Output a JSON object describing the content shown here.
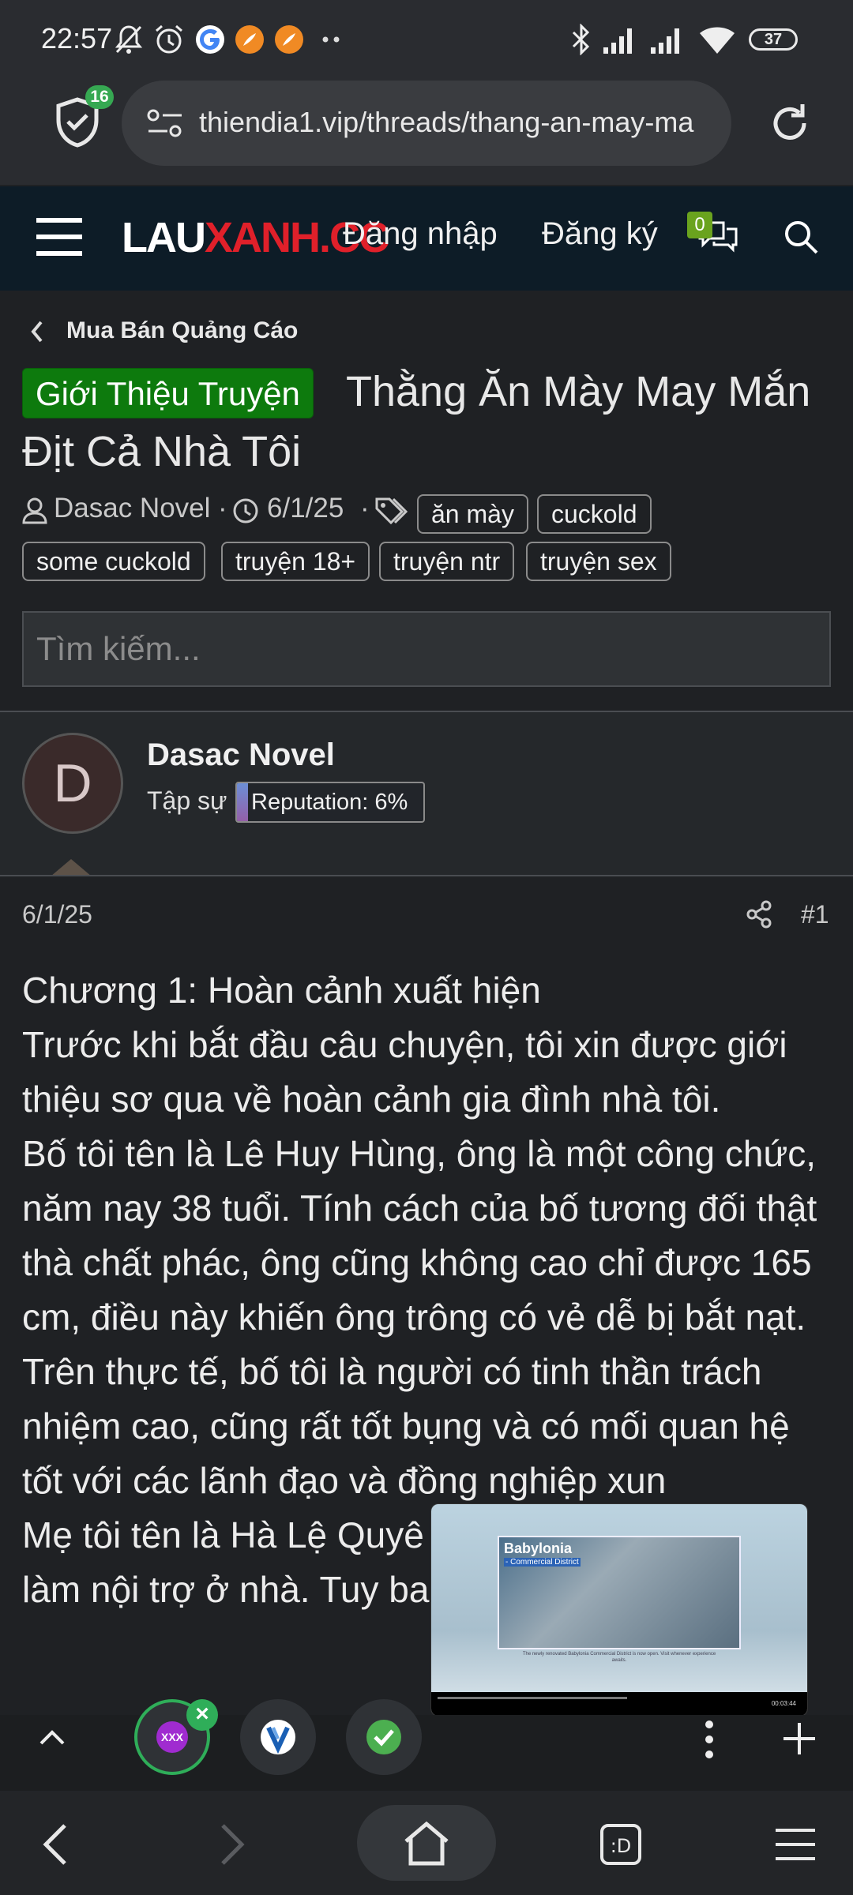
{
  "status_bar": {
    "time": "22:57",
    "battery": "37"
  },
  "browser": {
    "shield_count": "16",
    "url": "thiendia1.vip/threads/thang-an-may-ma"
  },
  "site_header": {
    "logo_part1": "LAU",
    "logo_part2": "XANH.CC",
    "login": "Đăng nhập",
    "register": "Đăng ký",
    "conversations_badge": "0",
    "colors": {
      "header_bg": "#0d1c27",
      "logo_red": "#e0202a",
      "badge_green": "#6aa31e"
    }
  },
  "thread": {
    "breadcrumb": "Mua Bán Quảng Cáo",
    "prefix": "Giới Thiệu Truyện",
    "title": "Thằng Ăn Mày May Mắn Địt Cả Nhà Tôi",
    "author": "Dasac Novel",
    "date": "6/1/25",
    "separator": "·",
    "tags": [
      "ăn mày",
      "cuckold",
      "some cuckold",
      "truyện 18+",
      "truyện ntr",
      "truyện sex"
    ],
    "prefix_color": "#0d7a0d"
  },
  "search": {
    "placeholder": "Tìm kiếm..."
  },
  "post": {
    "avatar_letter": "D",
    "author_name": "Dasac Novel",
    "user_title": "Tập sự",
    "reputation_label": "Reputation: 6%",
    "reputation_percent": 6,
    "date": "6/1/25",
    "number": "#1",
    "body": [
      "Chương 1: Hoàn cảnh xuất hiện",
      "Trước khi bắt đầu câu chuyện, tôi xin được giới thiệu sơ qua về hoàn cảnh gia đình nhà tôi.",
      "Bố tôi tên là Lê Huy Hùng, ông là một công chức, năm nay 38 tuổi. Tính cách của bố tương đối thật thà chất phác, ông cũng không cao chỉ được 165 cm, điều này khiến ông trông có vẻ dễ bị bắt nạt. Trên thực tế, bố tôi là người có tinh thần trách nhiệm cao, cũng rất tốt bụng và có mối quan hệ tốt với các lãnh đạo và đồng nghiệp xun",
      "Mẹ tôi tên là Hà Lệ Quyê",
      "làm nội trợ ở nhà. Tuy ba"
    ]
  },
  "video_overlay": {
    "title": "Babylonia",
    "subtitle": "- Commercial District",
    "caption": "The newly renovated Babylonia Commercial District is now open. Visit whenever experience awaits.",
    "time": "00:03:44"
  },
  "tab_strip": {
    "tab1_label": "XXX"
  },
  "icons": [
    "bell-off-icon",
    "alarm-icon",
    "google-icon",
    "app-icon",
    "bluetooth-icon",
    "signal-icon",
    "wifi-icon",
    "battery-icon",
    "shield-icon",
    "site-settings-icon",
    "reload-icon",
    "hamburger-icon",
    "conversations-icon",
    "search-icon",
    "chevron-left-icon",
    "user-icon",
    "clock-icon",
    "tag-icon",
    "share-icon",
    "chevron-up-icon",
    "more-vert-icon",
    "plus-icon",
    "back-icon",
    "forward-icon",
    "home-icon",
    "tabs-icon",
    "menu-icon"
  ]
}
